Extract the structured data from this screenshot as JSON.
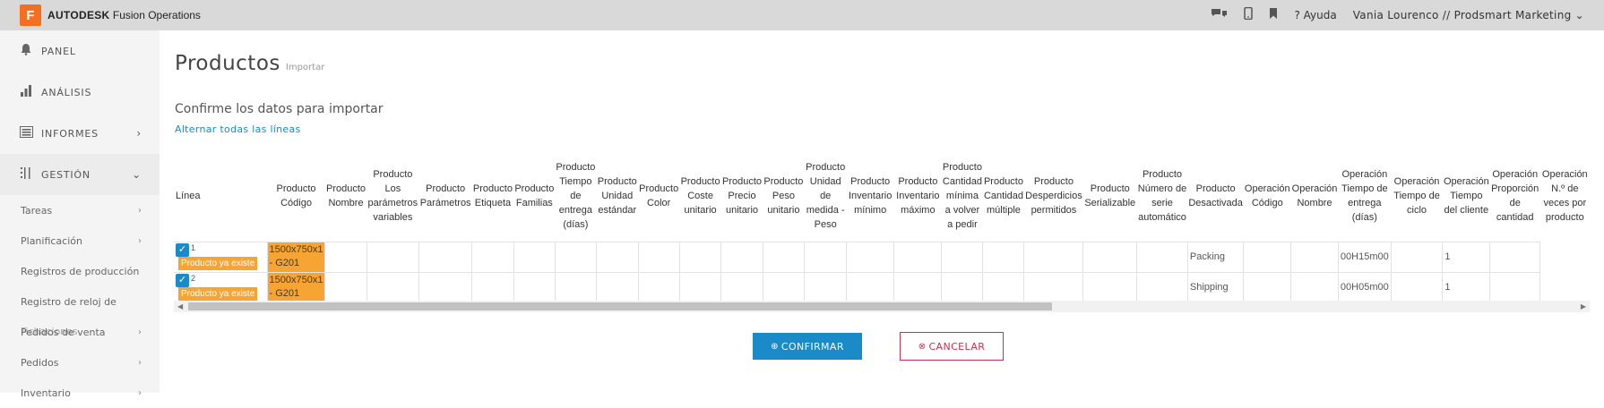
{
  "app": {
    "logo_letter": "F",
    "brand": "AUTODESK",
    "product": "Fusion Operations"
  },
  "topbar": {
    "help_label": "Ayuda",
    "user": "Vania Lourenco // Prodsmart Marketing"
  },
  "sidebar": {
    "main": [
      {
        "label": "PANEL",
        "icon": "bell-icon"
      },
      {
        "label": "ANÁLISIS",
        "icon": "bar-chart-icon"
      },
      {
        "label": "INFORMES",
        "icon": "report-icon"
      },
      {
        "label": "GESTIÓN",
        "icon": "management-icon"
      }
    ],
    "sub": [
      "Tareas",
      "Planificación",
      "Registros de producción",
      "Registro de reloj de",
      "Pedidos de venta",
      "Pedidos",
      "Inventario"
    ],
    "overlap_label": "Fichaciones"
  },
  "page": {
    "title": "Productos",
    "title_sub": "Importar",
    "subheading": "Confirme los datos para importar",
    "toggle_all": "Alternar todas las líneas"
  },
  "table": {
    "headers": [
      "Línea",
      "Producto Código",
      "Producto Nombre",
      "Producto Los parámetros variables",
      "Producto Parámetros",
      "Producto Etiqueta",
      "Producto Familias",
      "Producto Tiempo de entrega (días)",
      "Producto Unidad estándar",
      "Producto Color",
      "Producto Coste unitario",
      "Producto Precio unitario",
      "Producto Peso unitario",
      "Producto Unidad de medida - Peso",
      "Producto Inventario mínimo",
      "Producto Inventario máximo",
      "Producto Cantidad mínima a volver a pedir",
      "Producto Cantidad múltiple",
      "Producto Desperdicios permitidos",
      "Producto Serializable",
      "Producto Número de serie automático",
      "Producto Desactivada",
      "Operación Código",
      "Operación Nombre",
      "Operación Tiempo de entrega (días)",
      "Operación Tiempo de ciclo",
      "Operación Tiempo del cliente",
      "Operación Proporción de cantidad",
      "Operación N.º de veces por producto"
    ],
    "rows": [
      {
        "line": "1",
        "badge": "Producto ya existe",
        "code": "1500x750x1 - G201",
        "op_code": "Packing",
        "cycle": "00H15m00",
        "ratio": "1"
      },
      {
        "line": "2",
        "badge": "Producto ya existe",
        "code": "1500x750x1 - G201",
        "op_code": "Shipping",
        "cycle": "00H05m00",
        "ratio": "1"
      }
    ]
  },
  "buttons": {
    "confirm": "CONFIRMAR",
    "cancel": "CANCELAR"
  },
  "colors": {
    "accent": "#1a8ac8",
    "warning": "#f6a434",
    "danger": "#c9304b",
    "brand": "#f36f21"
  }
}
